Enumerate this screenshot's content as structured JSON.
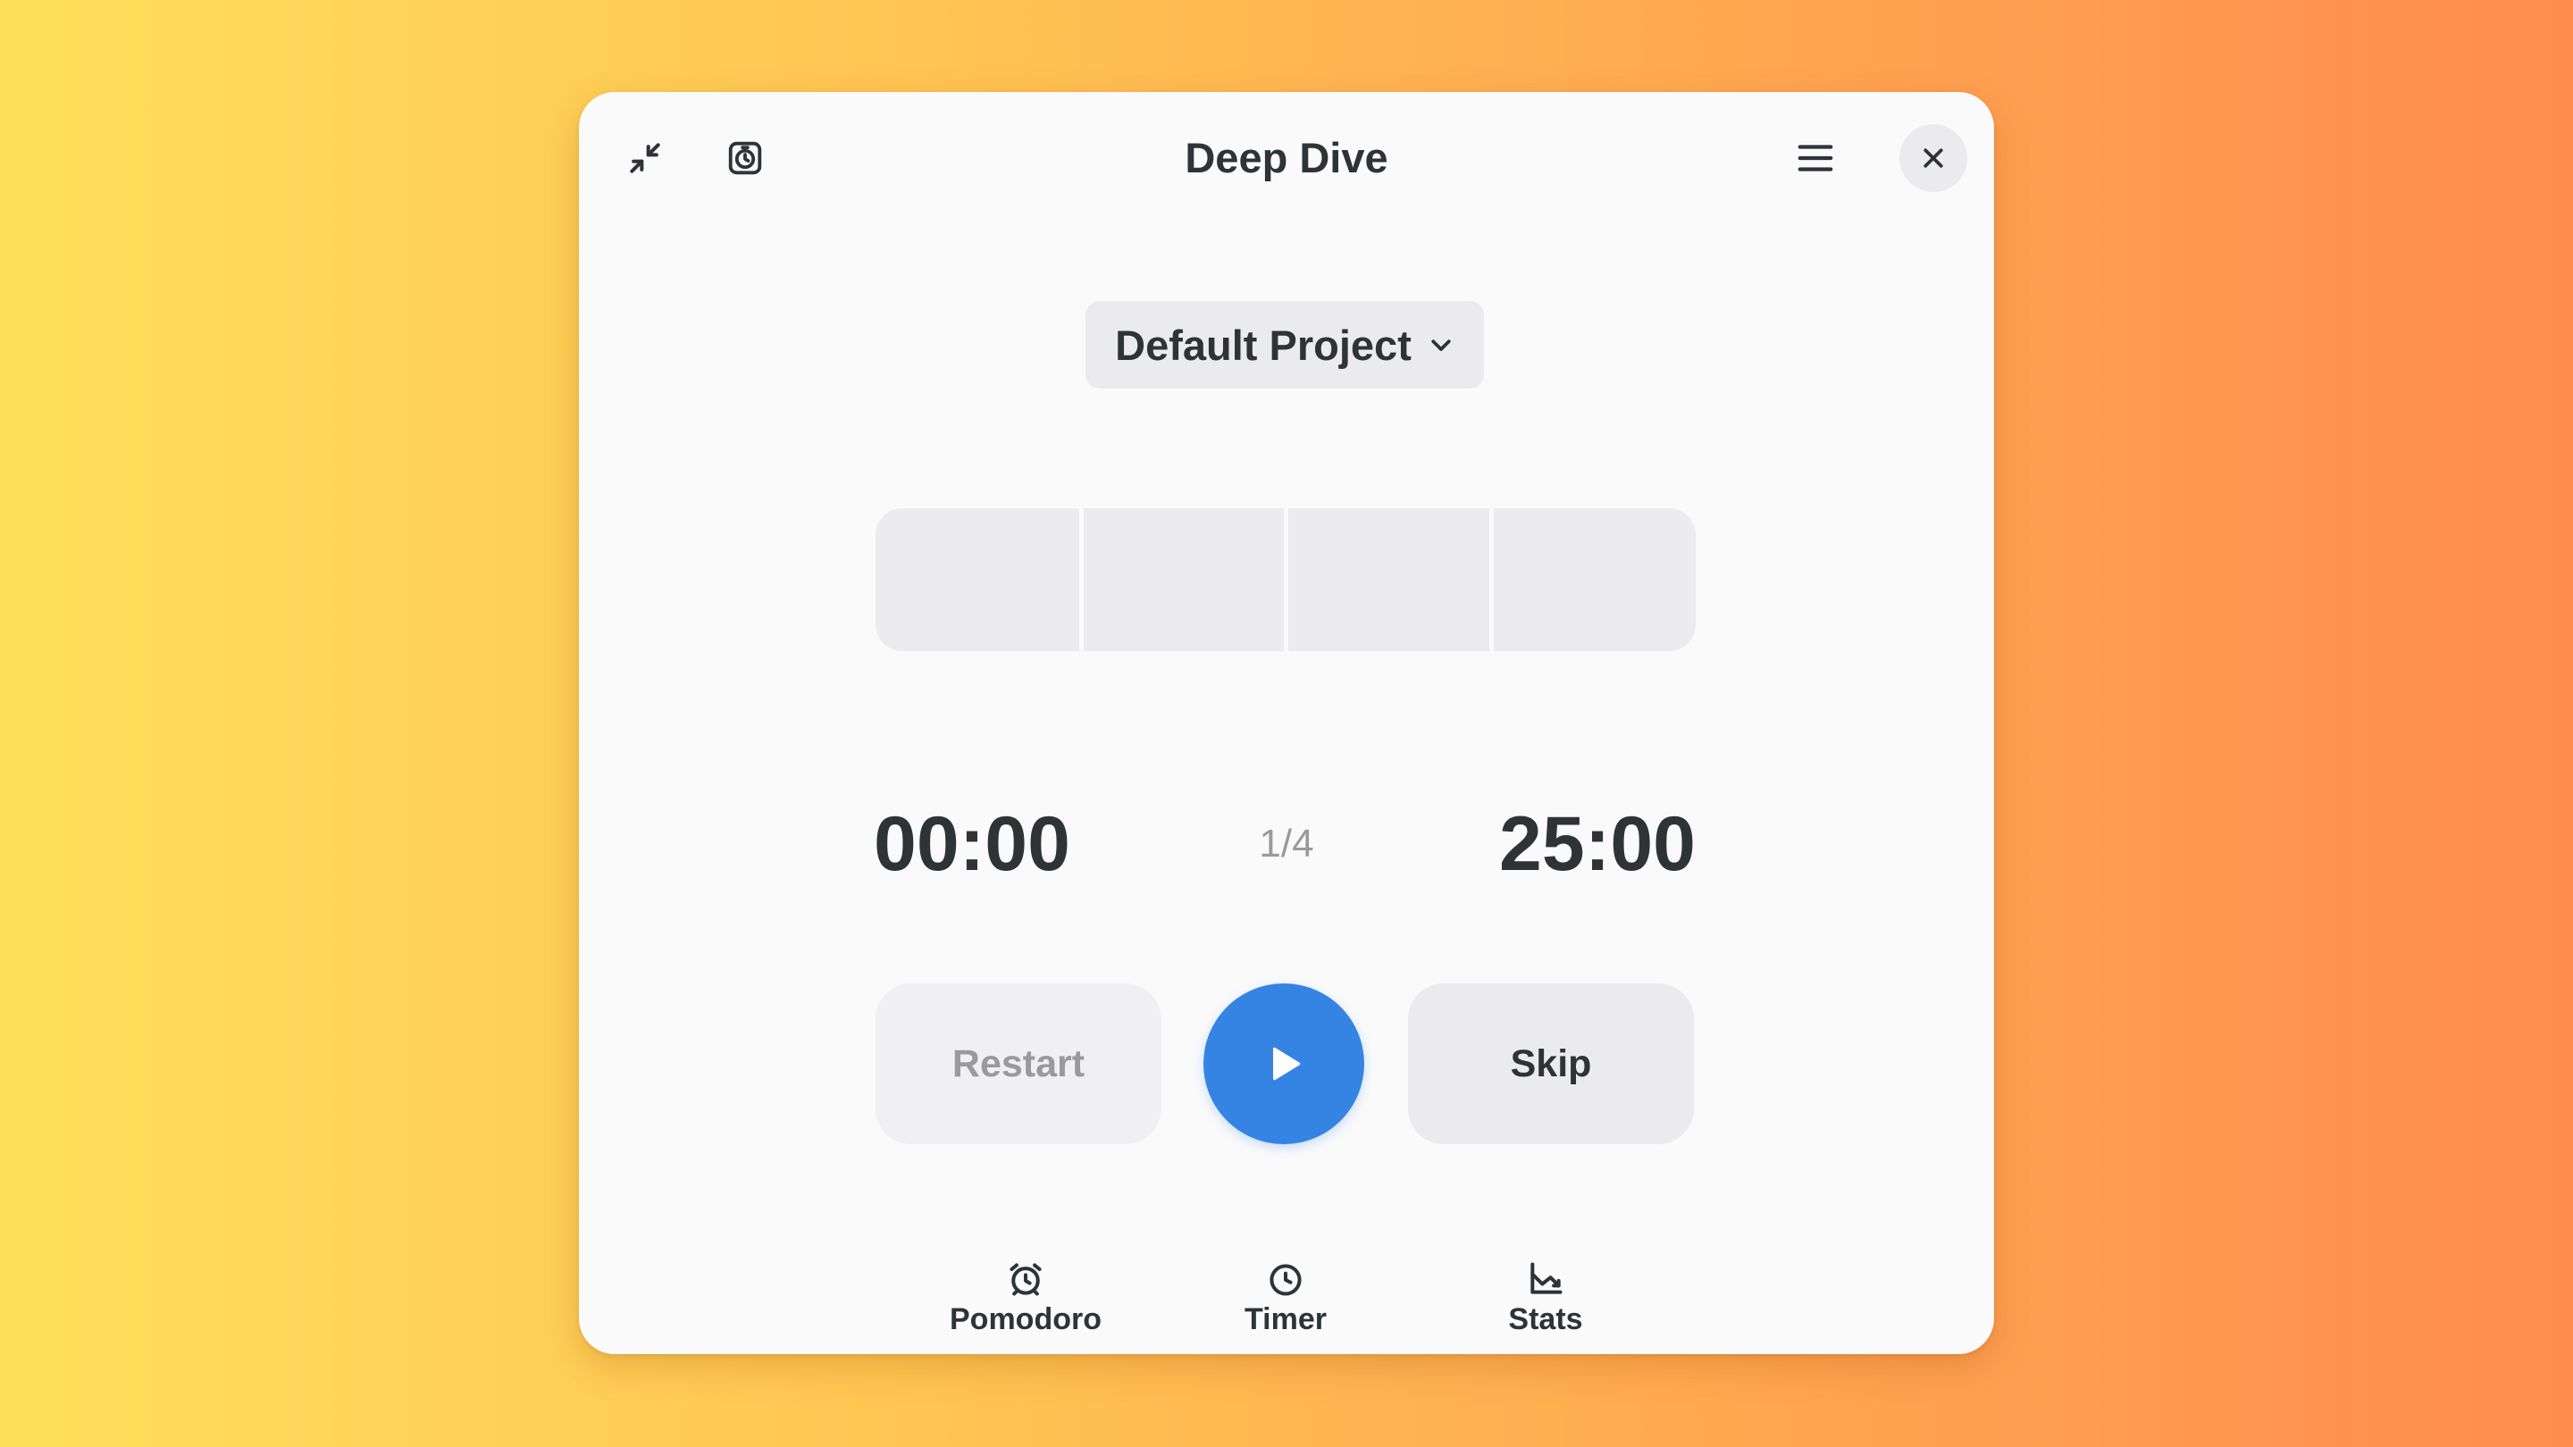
{
  "window": {
    "title": "Deep Dive"
  },
  "header": {
    "left_icons": [
      "unfullscreen-icon",
      "mini-window-icon"
    ],
    "right_icons": [
      "hamburger-menu-icon",
      "close-icon"
    ]
  },
  "project": {
    "selected": "Default Project",
    "icon": "chevron-down-icon"
  },
  "progress": {
    "sessions_total": 4,
    "current_session": 1,
    "fraction_complete": 0
  },
  "timer": {
    "elapsed": "00:00",
    "remaining": "25:00",
    "session_counter": "1/4"
  },
  "controls": {
    "restart_label": "Restart",
    "play_icon": "play-icon",
    "skip_label": "Skip"
  },
  "nav": {
    "tabs": [
      {
        "label": "Pomodoro",
        "icon": "alarm-clock-icon",
        "active": true
      },
      {
        "label": "Timer",
        "icon": "stopwatch-icon",
        "active": false
      },
      {
        "label": "Stats",
        "icon": "chart-icon",
        "active": false
      }
    ]
  },
  "colors": {
    "accent": "#3584e4",
    "window_bg": "#fafafb",
    "button_bg": "#ebebed",
    "text": "#2e3436",
    "dim_text": "#9a9a9c"
  }
}
